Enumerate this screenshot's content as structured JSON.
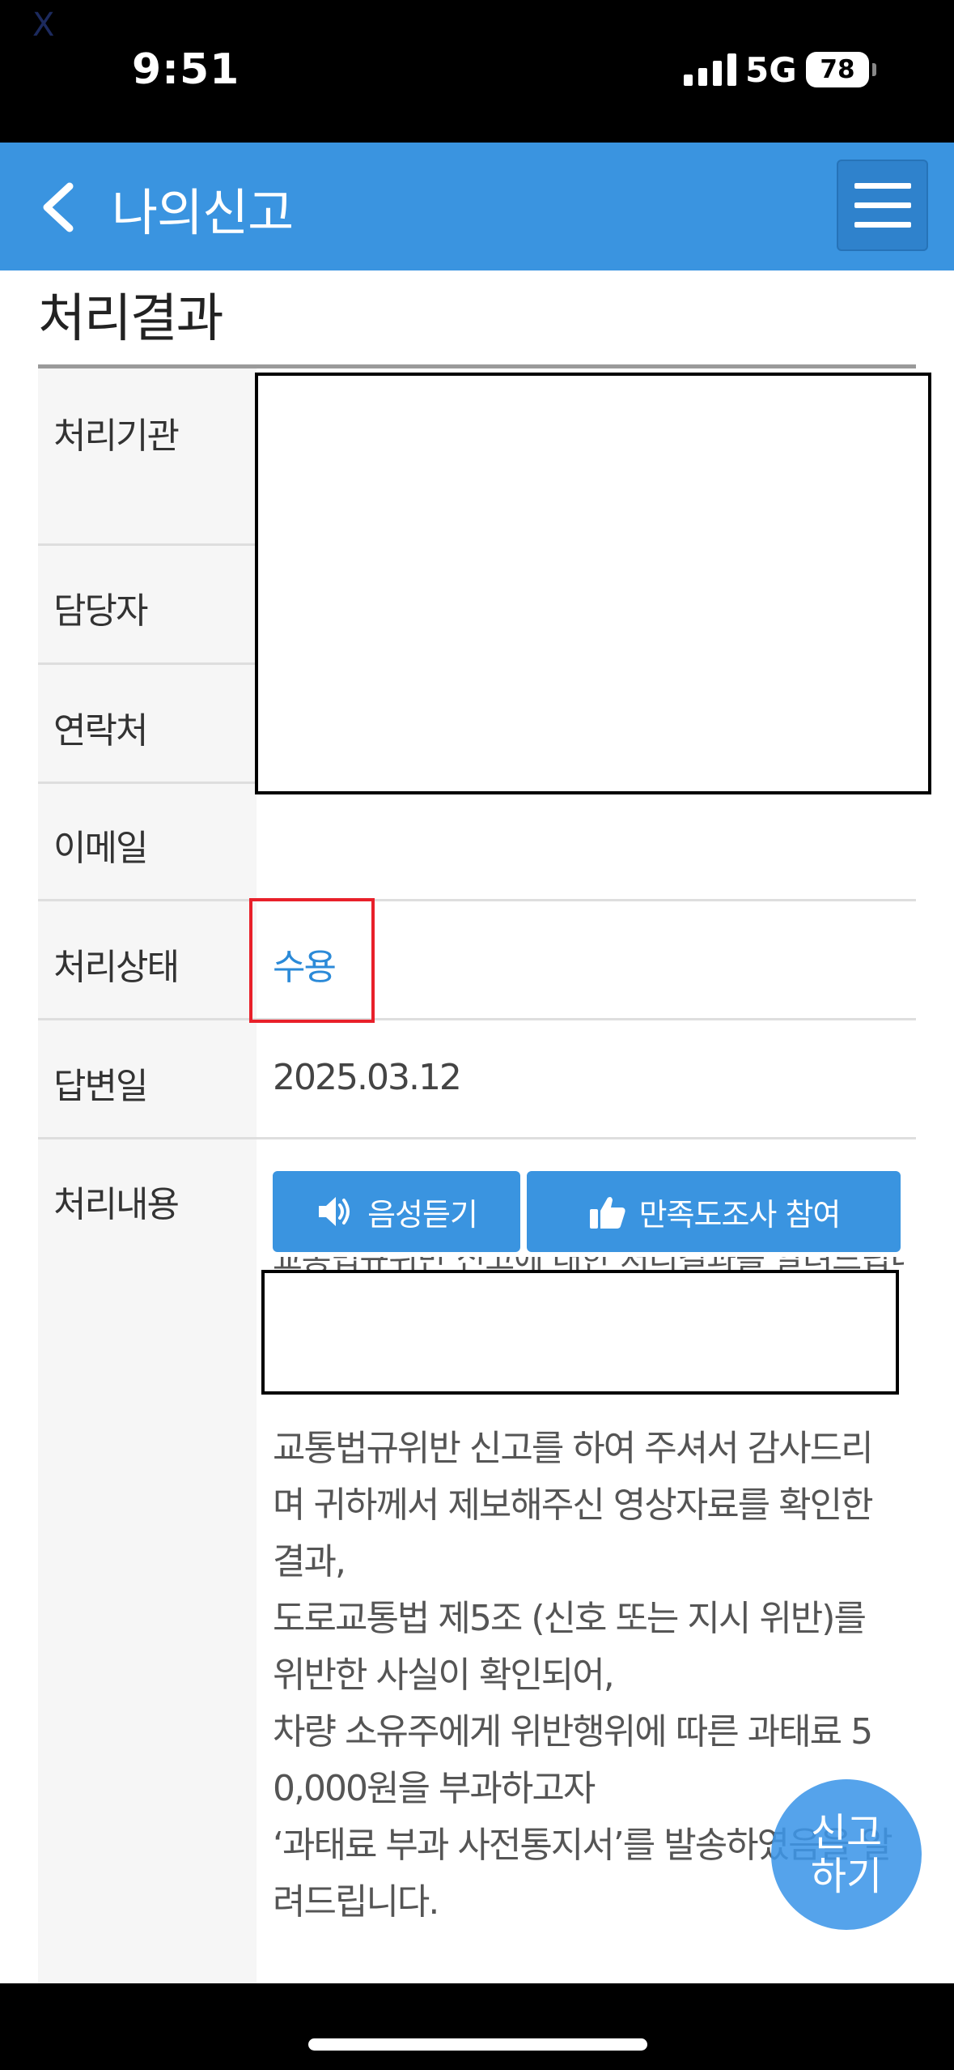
{
  "status_bar": {
    "time": "9:51",
    "network": "5G",
    "battery": "78",
    "corner_mark": "X"
  },
  "header": {
    "title": "나의신고",
    "back_icon": "chevron-left-icon",
    "menu_icon": "hamburger-menu-icon"
  },
  "section": {
    "title": "처리결과"
  },
  "rows": {
    "agency_label": "처리기관",
    "manager_label": "담당자",
    "contact_label": "연락처",
    "email_label": "이메일",
    "status_label": "처리상태",
    "status_value": "수용",
    "answer_date_label": "답변일",
    "answer_date_value": "2025.03.12",
    "content_label": "처리내용"
  },
  "actions": {
    "voice_label": "음성듣기",
    "voice_icon": "speaker-icon",
    "survey_label": "만족도조사 참여",
    "survey_icon": "thumbs-up-icon"
  },
  "partial_line": "교통법규위반 신고에 대한 처리결과를 알려드립니다",
  "body_lines": [
    "교통법규위반 신고를 하여 주셔서 감사드리",
    "며 귀하께서 제보해주신 영상자료를 확인한",
    "결과,",
    "도로교통법 제5조 (신호 또는 지시 위반)를",
    "위반한 사실이 확인되어,",
    "차량 소유주에게 위반행위에 따른 과태료 5",
    "0,000원을 부과하고자",
    "‘과태료 부과 사전통지서’를 발송하였음을 알",
    "려드립니다."
  ],
  "fab": {
    "line1": "신고",
    "line2": "하기"
  },
  "colors": {
    "header_blue": "#3a94e0",
    "status_blue": "#2b8ad8",
    "highlight_red": "#e8202a"
  }
}
